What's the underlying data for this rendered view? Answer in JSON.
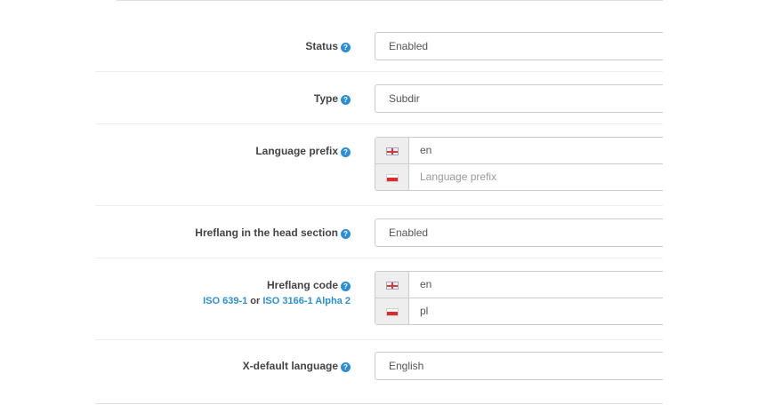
{
  "form": {
    "status": {
      "label": "Status",
      "value": "Enabled"
    },
    "type": {
      "label": "Type",
      "value": "Subdir"
    },
    "language_prefix": {
      "label": "Language prefix",
      "entries": [
        {
          "flag": "uk-flag-icon",
          "value": "en",
          "placeholder": ""
        },
        {
          "flag": "pl-flag-icon",
          "value": "",
          "placeholder": "Language prefix"
        }
      ]
    },
    "hreflang_head": {
      "label": "Hreflang in the head section",
      "value": "Enabled"
    },
    "hreflang_code": {
      "label": "Hreflang code",
      "link1": "ISO 639-1",
      "connector": "or",
      "link2": "ISO 3166-1 Alpha 2",
      "entries": [
        {
          "flag": "uk-flag-icon",
          "value": "en"
        },
        {
          "flag": "pl-flag-icon",
          "value": "pl"
        }
      ]
    },
    "x_default": {
      "label": "X-default language",
      "value": "English"
    }
  },
  "help_icon_glyph": "?",
  "colors": {
    "accent": "#2c8fd6",
    "border": "#cccccc",
    "addon_bg": "#eeeeee"
  }
}
